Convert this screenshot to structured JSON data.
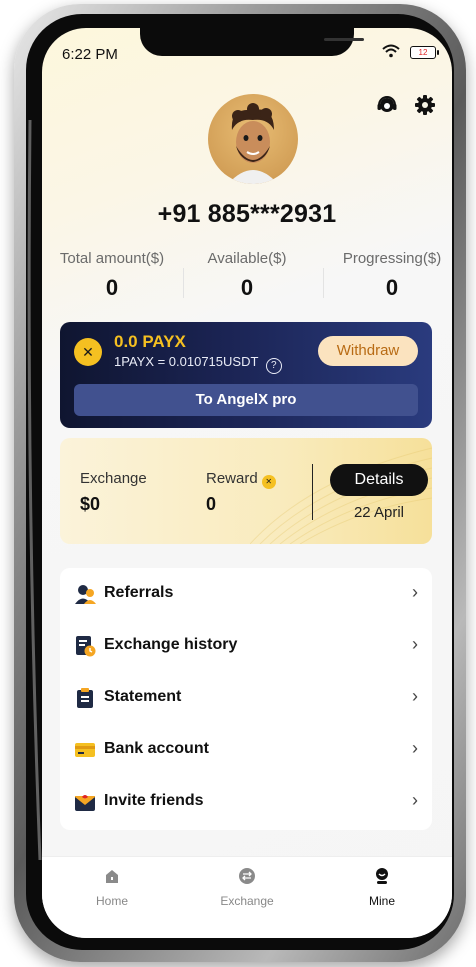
{
  "status_bar": {
    "time": "6:22 PM",
    "battery": "12"
  },
  "profile": {
    "phone": "+91 885***2931"
  },
  "stats": [
    {
      "label": "Total amount($)",
      "value": "0"
    },
    {
      "label": "Available($)",
      "value": "0"
    },
    {
      "label": "Progressing($)",
      "value": "0"
    }
  ],
  "payx_card": {
    "amount": "0.0 PAYX",
    "rate": "1PAYX = 0.010715USDT",
    "withdraw_label": "Withdraw",
    "angelx_label": "To AngelX pro"
  },
  "exchange_card": {
    "exchange_label": "Exchange",
    "exchange_value": "$0",
    "reward_label": "Reward",
    "reward_value": "0",
    "details_label": "Details",
    "date": "22 April"
  },
  "menu": [
    {
      "label": "Referrals",
      "icon": "referrals-icon"
    },
    {
      "label": "Exchange history",
      "icon": "exchange-history-icon"
    },
    {
      "label": "Statement",
      "icon": "statement-icon"
    },
    {
      "label": "Bank account",
      "icon": "bank-card-icon"
    },
    {
      "label": "Invite friends",
      "icon": "invite-envelope-icon"
    }
  ],
  "tabbar": [
    {
      "label": "Home",
      "icon": "home-icon"
    },
    {
      "label": "Exchange",
      "icon": "exchange-icon"
    },
    {
      "label": "Mine",
      "icon": "mine-icon"
    }
  ],
  "colors": {
    "accent_gold": "#f5c021",
    "card_navy": "#1b2454",
    "withdraw_bg": "#fbe3bf"
  }
}
